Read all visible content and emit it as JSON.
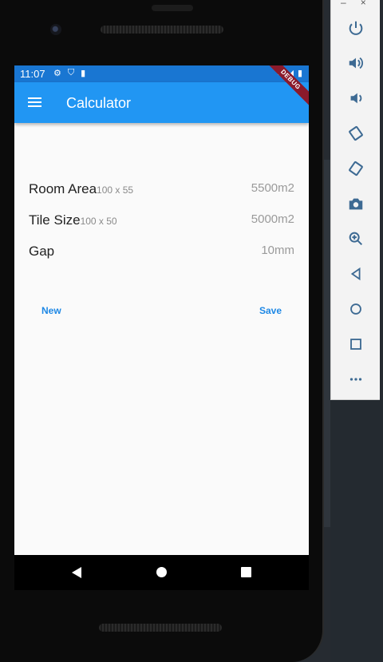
{
  "status": {
    "time": "11:07",
    "debug_banner": "DEBUG"
  },
  "appbar": {
    "title": "Calculator"
  },
  "rows": [
    {
      "label": "Room Area",
      "sub": "100 x 55",
      "value": "5500m2"
    },
    {
      "label": "Tile Size",
      "sub": "100 x 50",
      "value": "5000m2"
    },
    {
      "label": "Gap",
      "sub": "",
      "value": "10mm"
    }
  ],
  "actions": {
    "new_label": "New",
    "save_label": "Save"
  },
  "emulator": {
    "window_controls": [
      "–",
      "×"
    ],
    "buttons": [
      "power-icon",
      "volume-up-icon",
      "volume-down-icon",
      "rotate-left-icon",
      "rotate-right-icon",
      "camera-icon",
      "zoom-icon",
      "back-icon",
      "home-icon",
      "overview-icon",
      "more-icon"
    ]
  },
  "colors": {
    "appbar": "#2196f3",
    "statusbar": "#1976d2",
    "accent": "#1e88e5"
  }
}
